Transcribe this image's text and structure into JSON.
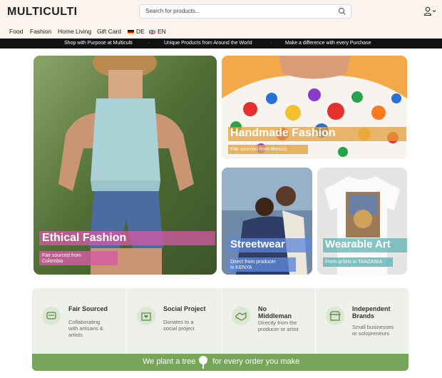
{
  "header": {
    "logo": "MULTICULTI",
    "search_placeholder": "Search for products..."
  },
  "nav": {
    "items": [
      "Food",
      "Fashion",
      "Home Living",
      "Gift Card"
    ],
    "lang_de": "DE",
    "lang_en": "EN"
  },
  "banner": {
    "items": [
      "Shop with Purpose at Multiculti",
      "Unique Products from Around the World",
      "Make a difference with every Purchase"
    ],
    "separator": "·"
  },
  "cards": {
    "ethical": {
      "title": "Ethical Fashion",
      "subtitle_line1": "Fair sourced from",
      "subtitle_line2": "Colombia"
    },
    "handmade": {
      "title": "Handmade Fashion",
      "subtitle": "Fair sourced from Mexico"
    },
    "streetwear": {
      "title": "Streetwear",
      "subtitle_line1": "Direct from producer",
      "subtitle_line2": "in KENYA"
    },
    "wearable": {
      "title": "Wearable Art",
      "subtitle": "From artists in TANZANIA"
    }
  },
  "info": [
    {
      "title_line1": "Fair Sourced",
      "title_line2": "",
      "desc": [
        "Collaborating",
        "with artisans &",
        "artists"
      ],
      "icon": "hands-icon"
    },
    {
      "title_line1": "Social Project",
      "title_line2": "",
      "desc": [
        "Donates to a",
        "social project"
      ],
      "icon": "heart-box-icon"
    },
    {
      "title_line1": "No",
      "title_line2": "Middleman",
      "desc": [
        "Directly from the",
        "producer or artist"
      ],
      "icon": "handshake-icon"
    },
    {
      "title_line1": "Independent",
      "title_line2": "Brands",
      "desc": [
        "Small businesses",
        "or solopreneurs"
      ],
      "icon": "storefront-icon"
    }
  ],
  "tree_banner": {
    "left": "We plant a tree",
    "right": "for every order you make"
  },
  "colors": {
    "brand": "#e6196b",
    "banner_bg": "#111111",
    "header_bg": "#fbf3ee",
    "green": "#77a55a",
    "ethical_label": "#d75aa6",
    "handmade_label": "#e3a23d",
    "streetwear_label": "#5d86d8",
    "wearable_label": "#5fb3b3"
  }
}
